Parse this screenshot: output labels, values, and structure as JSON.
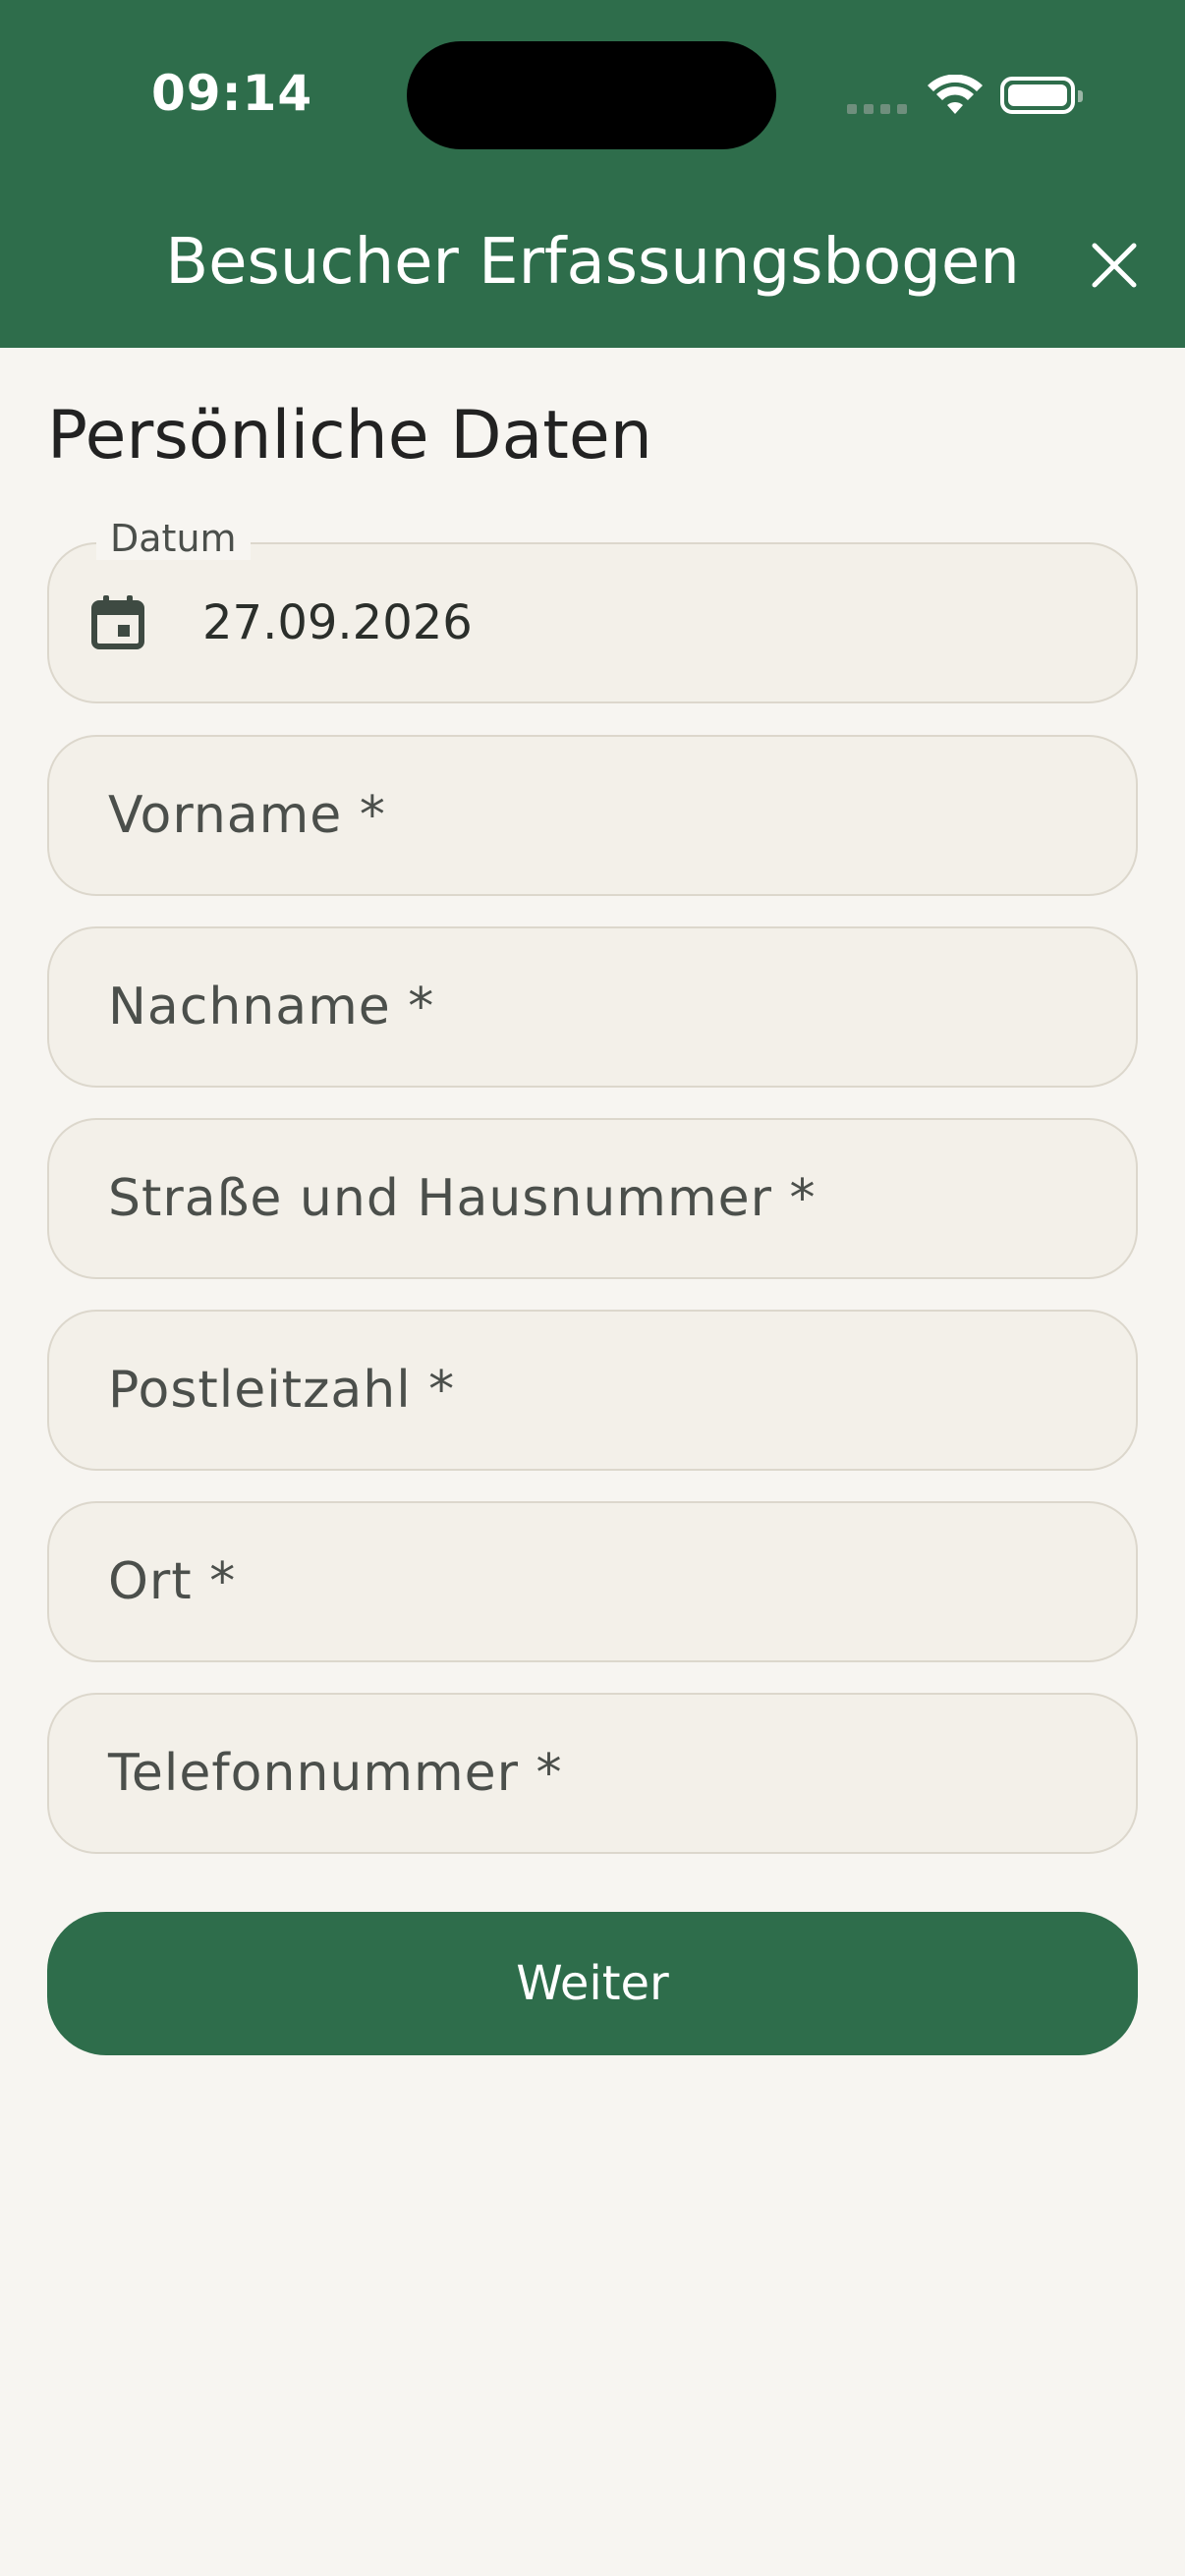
{
  "status_bar": {
    "time": "09:14"
  },
  "header": {
    "title": "Besucher Erfassungsbogen",
    "close_icon": "close-icon"
  },
  "section": {
    "title": "Persönliche Daten"
  },
  "form": {
    "date": {
      "label": "Datum",
      "value": "27.09.2026",
      "icon": "calendar-icon"
    },
    "first_name": {
      "placeholder": "Vorname *"
    },
    "last_name": {
      "placeholder": "Nachname *"
    },
    "street": {
      "placeholder": "Straße und Hausnummer *"
    },
    "postal_code": {
      "placeholder": "Postleitzahl *"
    },
    "city": {
      "placeholder": "Ort *"
    },
    "phone": {
      "placeholder": "Telefonnummer *"
    }
  },
  "actions": {
    "next_label": "Weiter"
  },
  "colors": {
    "primary": "#2e6d4b",
    "background": "#f7f5f1",
    "field_bg": "#f3f0e9",
    "field_border": "#dcd7cc"
  }
}
